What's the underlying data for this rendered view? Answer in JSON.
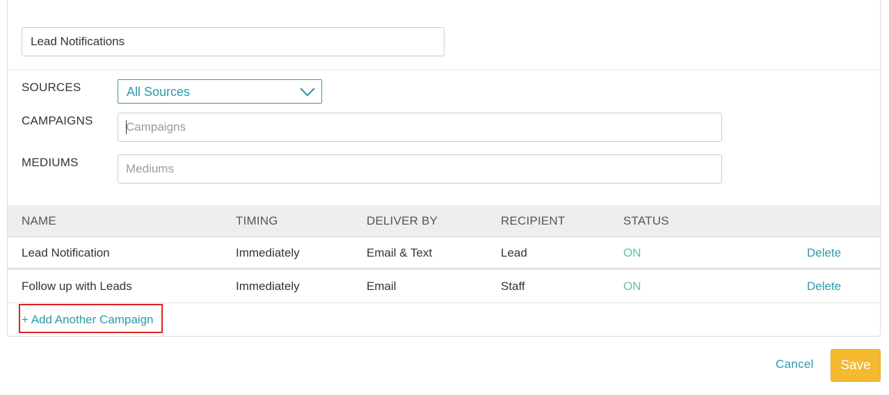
{
  "form": {
    "name_value": "Lead Notifications"
  },
  "filters": {
    "sources_label": "SOURCES",
    "sources_selected": "All Sources",
    "campaigns_label": "CAMPAIGNS",
    "campaigns_placeholder": "Campaigns",
    "mediums_label": "MEDIUMS",
    "mediums_placeholder": "Mediums"
  },
  "table": {
    "headers": {
      "name": "NAME",
      "timing": "TIMING",
      "deliver_by": "DELIVER BY",
      "recipient": "RECIPIENT",
      "status": "STATUS"
    },
    "rows": [
      {
        "name": "Lead Notification",
        "timing": "Immediately",
        "deliver_by": "Email & Text",
        "recipient": "Lead",
        "status": "ON",
        "action": "Delete"
      },
      {
        "name": "Follow up with Leads",
        "timing": "Immediately",
        "deliver_by": "Email",
        "recipient": "Staff",
        "status": "ON",
        "action": "Delete"
      }
    ],
    "add_label": "+ Add Another Campaign"
  },
  "actions": {
    "cancel_label": "Cancel",
    "save_label": "Save"
  },
  "colors": {
    "accent": "#2b9aa8",
    "status_on": "#5fc29a",
    "save_bg": "#f4b92f",
    "highlight_border": "#e02020"
  },
  "icons": {
    "dropdown": "chevron-down-icon"
  }
}
